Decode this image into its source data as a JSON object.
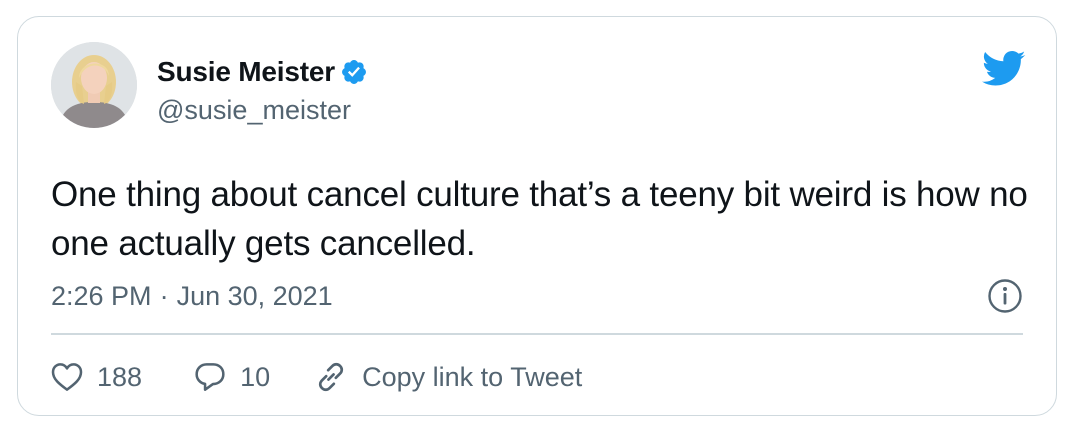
{
  "author": {
    "display_name": "Susie Meister",
    "handle": "@susie_meister",
    "verified": true,
    "avatar_icon": "user-avatar"
  },
  "tweet": {
    "text": "One thing about cancel culture that’s a teeny bit weird is how no one actually gets cancelled.",
    "time": "2:26 PM",
    "separator": "·",
    "date": "Jun 30, 2021"
  },
  "actions": {
    "likes": "188",
    "replies": "10",
    "copy_link_label": "Copy link to Tweet"
  },
  "icons": {
    "brand": "twitter-bird-icon",
    "verified": "verified-badge-icon",
    "info": "info-icon",
    "like": "heart-icon",
    "reply": "reply-bubble-icon",
    "link": "link-icon"
  },
  "colors": {
    "brand_blue": "#1d9bf0",
    "text_primary": "#0f1419",
    "text_secondary": "#536471",
    "border": "#cfd9de"
  }
}
